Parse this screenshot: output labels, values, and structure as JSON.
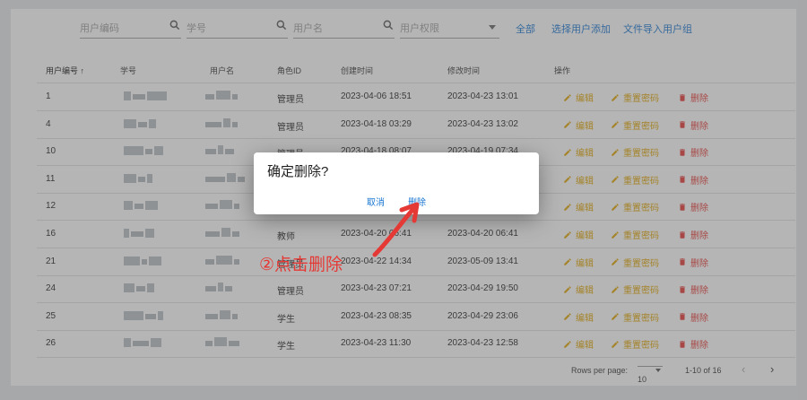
{
  "filters": {
    "user_code_placeholder": "用户编码",
    "student_id_placeholder": "学号",
    "username_placeholder": "用户名",
    "permission_placeholder": "用户权限",
    "links": [
      "全部",
      "选择用户添加",
      "文件导入用户组"
    ]
  },
  "table": {
    "headers": [
      "用户编号 ↑",
      "学号",
      "用户名",
      "角色ID",
      "创建时间",
      "修改时间",
      "操作"
    ],
    "rows": [
      {
        "id": "1",
        "role": "管理员",
        "created": "2023-04-06 18:51",
        "modified": "2023-04-23 13:01"
      },
      {
        "id": "4",
        "role": "管理员",
        "created": "2023-04-18 03:29",
        "modified": "2023-04-23 13:02"
      },
      {
        "id": "10",
        "role": "管理员",
        "created": "2023-04-18 08:07",
        "modified": "2023-04-19 07:34"
      },
      {
        "id": "11",
        "role": "",
        "created": "",
        "modified": ""
      },
      {
        "id": "12",
        "role": "",
        "created": "",
        "modified": ""
      },
      {
        "id": "16",
        "role": "教师",
        "created": "2023-04-20 06:41",
        "modified": "2023-04-20 06:41"
      },
      {
        "id": "21",
        "role": "管理员",
        "created": "2023-04-22 14:34",
        "modified": "2023-05-09 13:41"
      },
      {
        "id": "24",
        "role": "管理员",
        "created": "2023-04-23 07:21",
        "modified": "2023-04-29 19:50"
      },
      {
        "id": "25",
        "role": "学生",
        "created": "2023-04-23 08:35",
        "modified": "2023-04-29 23:06"
      },
      {
        "id": "26",
        "role": "学生",
        "created": "2023-04-23 11:30",
        "modified": "2023-04-23 12:58"
      }
    ],
    "actions": {
      "edit": "编辑",
      "reset": "重置密码",
      "delete": "删除"
    }
  },
  "pagination": {
    "rows_per_page_label": "Rows per page:",
    "rows_per_page_value": "10",
    "range": "1-10 of 16"
  },
  "dialog": {
    "title": "确定删除?",
    "cancel": "取消",
    "confirm": "删除"
  },
  "annotation": {
    "text": "②点击删除"
  },
  "colors": {
    "primary": "#1976d2",
    "warning": "#e0a400",
    "danger": "#e53935"
  }
}
